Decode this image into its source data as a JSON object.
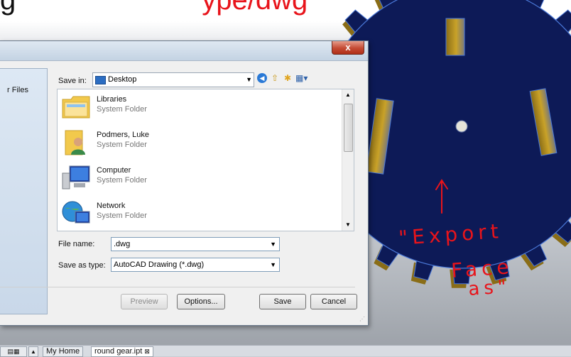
{
  "banner": {
    "lead_fragment": "g",
    "red_fragment": "ype/dwg"
  },
  "dialog": {
    "close_label": "x",
    "left_pane_label": "r Files",
    "save_in_label": "Save in:",
    "save_in_value": "Desktop",
    "files": [
      {
        "name": "Libraries",
        "type": "System Folder",
        "icon": "libraries-folder-icon"
      },
      {
        "name": "Podmers, Luke",
        "type": "System Folder",
        "icon": "user-folder-icon"
      },
      {
        "name": "Computer",
        "type": "System Folder",
        "icon": "computer-icon"
      },
      {
        "name": "Network",
        "type": "System Folder",
        "icon": "network-icon"
      }
    ],
    "file_name_label": "File name:",
    "file_name_value": ".dwg",
    "save_as_type_label": "Save as type:",
    "save_as_type_value": "AutoCAD Drawing (*.dwg)",
    "buttons": {
      "preview": "Preview",
      "options": "Options...",
      "save": "Save",
      "cancel": "Cancel"
    }
  },
  "annotation": {
    "line1": "\"Export",
    "line2": "Face",
    "line3": "as\"",
    "color": "#e8141b"
  },
  "tabs": {
    "home": "My Home",
    "file": "round gear.ipt",
    "file_close": "⊠"
  },
  "colors": {
    "gear_face": "#0d1a57",
    "gear_edge": "#4a78d8",
    "gear_side": "#8a6d17"
  }
}
